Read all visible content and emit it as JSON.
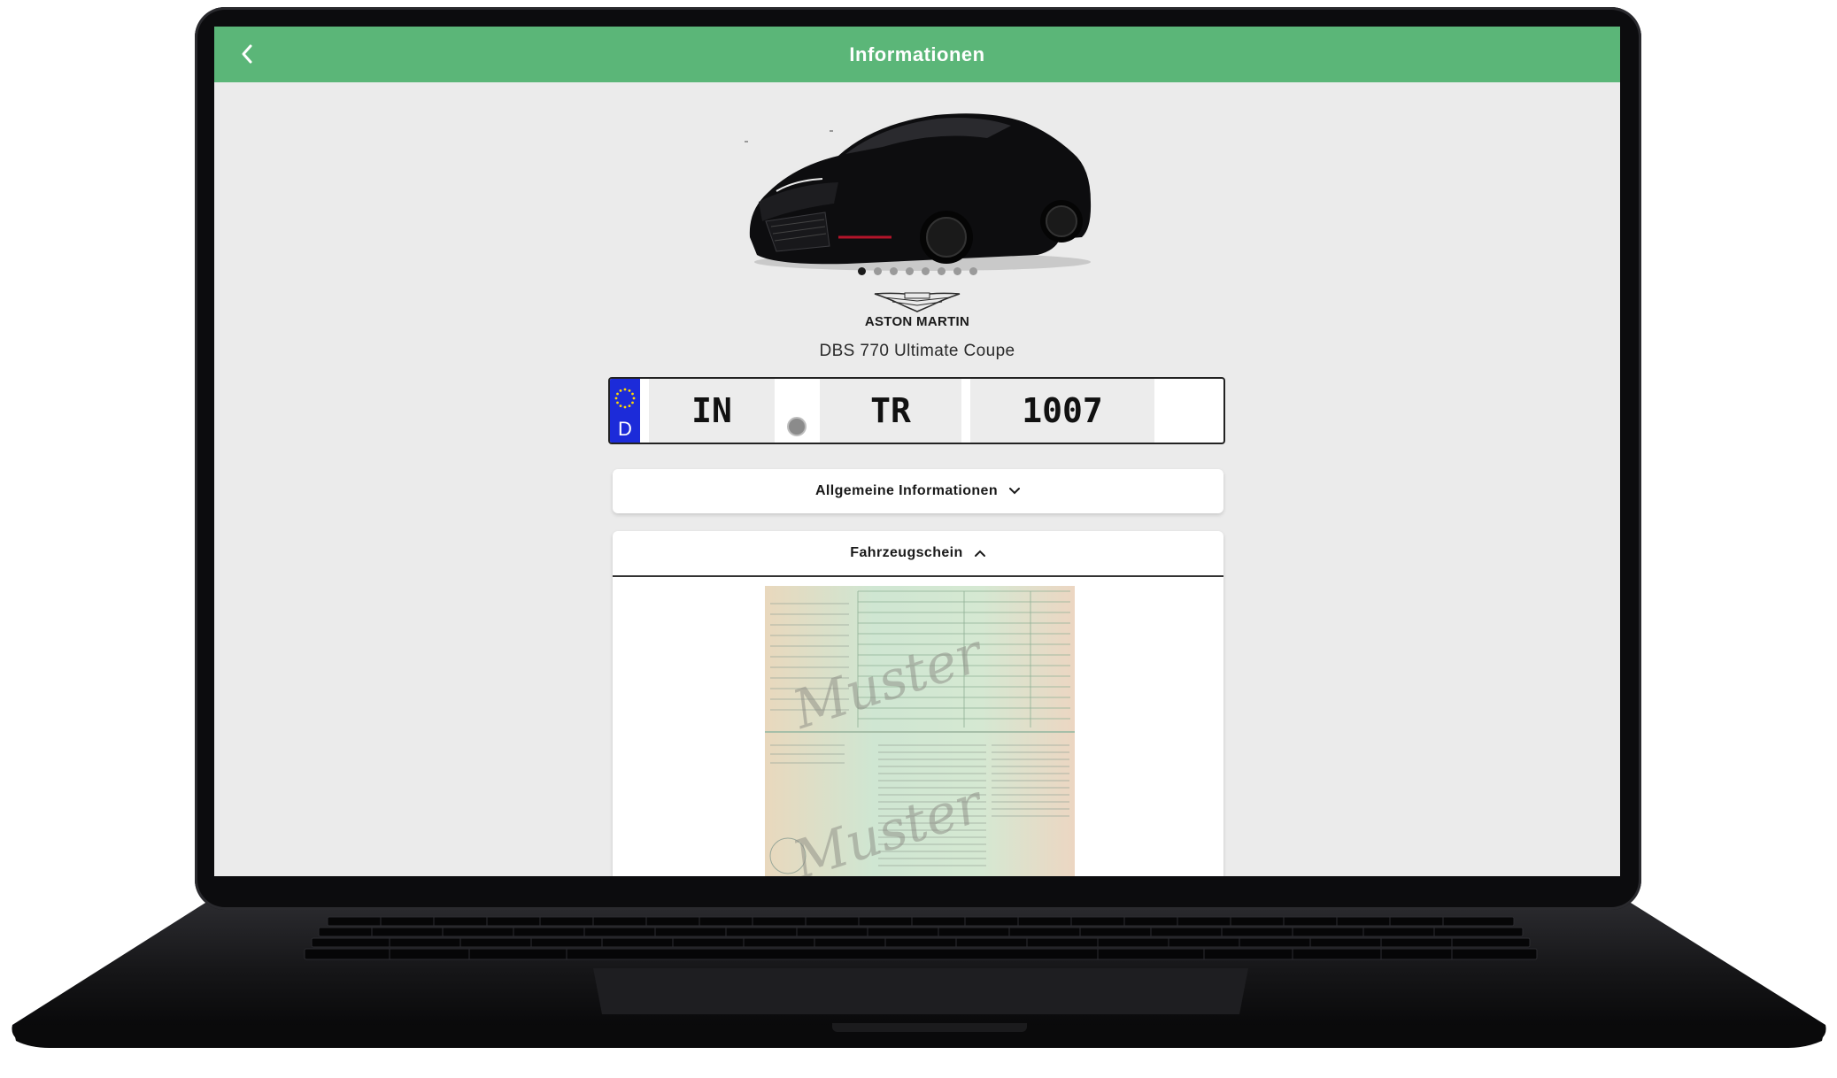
{
  "header": {
    "title": "Informationen",
    "back_icon": "chevron-left-icon"
  },
  "carousel": {
    "image": "black Aston Martin coupe",
    "total_slides": 8,
    "active_index": 0
  },
  "vehicle": {
    "brand_logo": "aston-martin-wings-logo",
    "brand": "ASTON MARTIN",
    "model": "DBS 770 Ultimate Coupe"
  },
  "plate": {
    "country": "D",
    "district": "IN",
    "letters": "TR",
    "number": "1007",
    "eu_color": "#1c2bd9"
  },
  "sections": {
    "general": {
      "label": "Allgemeine Informationen",
      "icon": "chevron-down-icon",
      "expanded": false
    },
    "registration": {
      "label": "Fahrzeugschein",
      "icon": "chevron-up-icon",
      "expanded": true,
      "document_image": "Zulassungsbescheinigung Teil I"
    }
  },
  "colors": {
    "accent": "#5bb678",
    "background": "#ebebeb"
  }
}
